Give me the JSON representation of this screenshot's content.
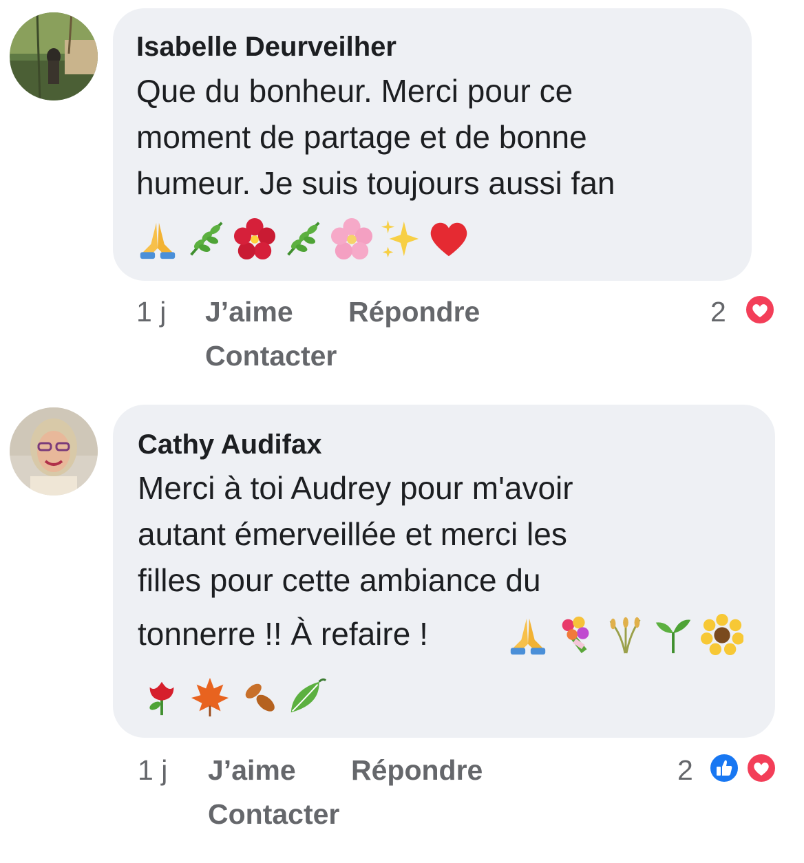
{
  "comments": [
    {
      "author": "Isabelle Deurveilher",
      "lines": [
        "Que du bonheur. Merci pour ce",
        "moment de partage et de bonne",
        "humeur. Je suis toujours aussi fan"
      ],
      "emojis": [
        "pray",
        "herb",
        "hibiscus",
        "herb",
        "cherry-blossom",
        "sparkles",
        "red-heart"
      ],
      "time": "1 j",
      "like_label": "J’aime",
      "reply_label": "Répondre",
      "contact_label": "Contacter",
      "reaction_count": "2",
      "reactions": [
        "love"
      ]
    },
    {
      "author": "Cathy Audifax",
      "lines": [
        "Merci à toi Audrey pour m'avoir",
        "autant émerveillée et merci les",
        "filles pour cette ambiance du",
        "tonnerre !! À refaire !"
      ],
      "emojis_inline": [
        "pray",
        "bouquet",
        "rice-sheaf",
        "seedling",
        "sunflower"
      ],
      "emojis": [
        "rose",
        "maple-leaf",
        "fallen-leaf",
        "leaf-fluttering"
      ],
      "time": "1 j",
      "like_label": "J’aime",
      "reply_label": "Répondre",
      "contact_label": "Contacter",
      "reaction_count": "2",
      "reactions": [
        "like",
        "love"
      ]
    }
  ],
  "colors": {
    "bubble": "#eef0f4",
    "meta_text": "#65676b",
    "love": "#f33e58",
    "like": "#1877f2"
  }
}
